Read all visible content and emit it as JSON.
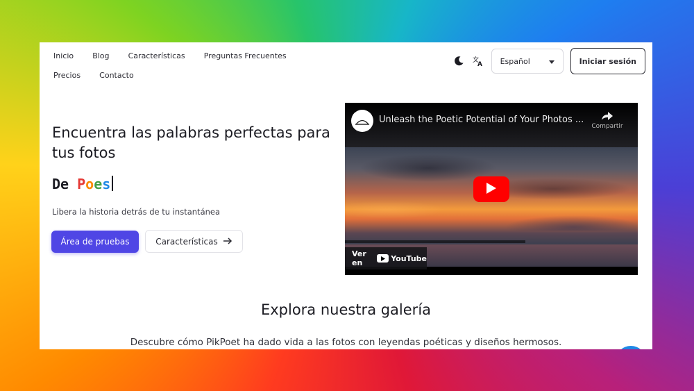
{
  "nav": {
    "links": [
      "Inicio",
      "Blog",
      "Características",
      "Preguntas Frecuentes",
      "Precios",
      "Contacto"
    ],
    "language": "Español",
    "login_label": "Iniciar sesión"
  },
  "hero": {
    "title": "Encuentra las palabras perfectas para tus fotos",
    "typed_prefix": "De ",
    "typed_word": "Poes",
    "subtitle": "Libera la historia detrás de tu instantánea",
    "primary_button": "Área de pruebas",
    "secondary_button": "Características"
  },
  "video": {
    "title": "Unleash the Poetic Potential of Your Photos ...",
    "share_label": "Compartir",
    "watch_on": "Ver en",
    "platform": "YouTube"
  },
  "gallery": {
    "title": "Explora nuestra galería",
    "subtitle": "Descubre cómo PikPoet ha dado vida a las fotos con leyendas poéticas y diseños hermosos."
  },
  "colors": {
    "accent": "#4f46e5",
    "play": "#ff0000",
    "typed_letters": [
      "#e53935",
      "#fb8c00",
      "#43a047",
      "#1e88e5"
    ]
  },
  "icons": [
    "moon-icon",
    "translate-icon",
    "caret-down-icon",
    "arrow-right-icon",
    "share-icon",
    "play-icon"
  ]
}
